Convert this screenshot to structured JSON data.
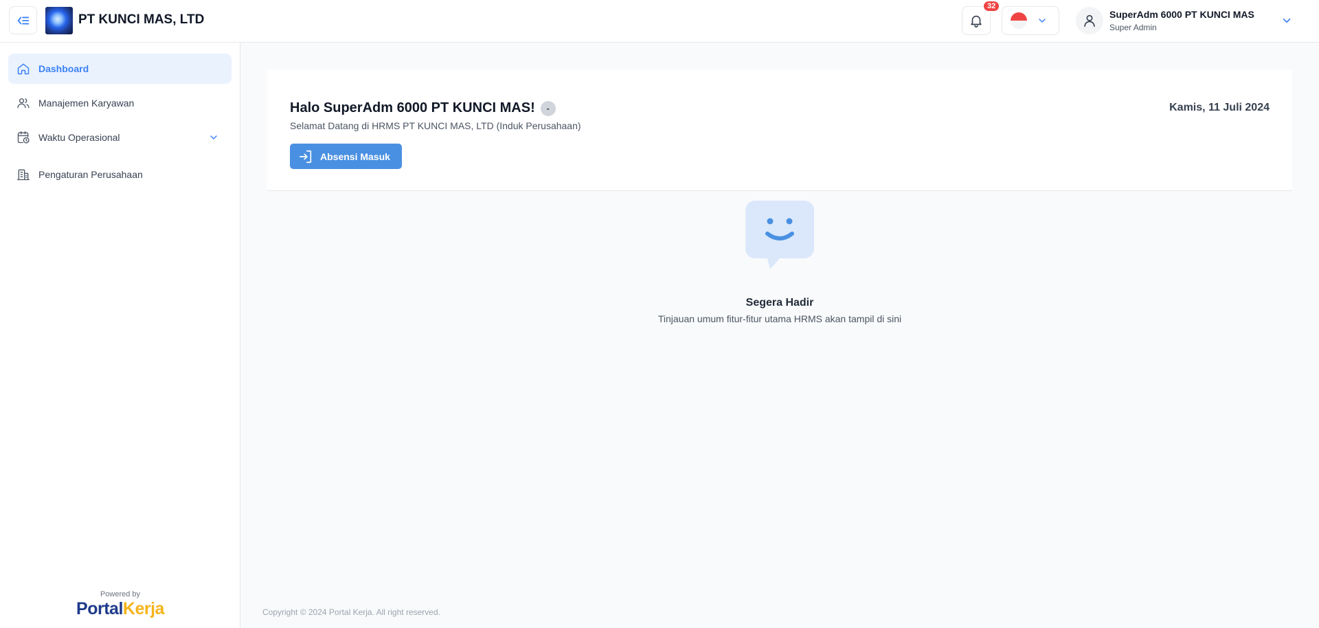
{
  "header": {
    "company_name": "PT KUNCI MAS, LTD",
    "notification_count": "32",
    "user_name": "SuperAdm 6000 PT KUNCI MAS",
    "user_role": "Super Admin"
  },
  "sidebar": {
    "items": [
      {
        "label": "Dashboard",
        "icon": "home-icon",
        "active": true
      },
      {
        "label": "Manajemen Karyawan",
        "icon": "users-icon"
      },
      {
        "label": "Waktu Operasional",
        "icon": "calendar-clock-icon",
        "expandable": true
      },
      {
        "label": "Pengaturan Perusahaan",
        "icon": "building-icon"
      }
    ],
    "powered_by": "Powered by",
    "brand_part1": "Portal",
    "brand_part2": "Kerja"
  },
  "welcome": {
    "greeting": "Halo SuperAdm 6000 PT KUNCI MAS!",
    "badge": "-",
    "subtitle": "Selamat Datang di HRMS PT KUNCI MAS, LTD (Induk Perusahaan)",
    "checkin_label": "Absensi Masuk",
    "date": "Kamis, 11 Juli 2024"
  },
  "empty_state": {
    "title": "Segera Hadir",
    "description": "Tinjauan umum fitur-fitur utama HRMS akan tampil di sini"
  },
  "footer": {
    "copyright": "Copyright © 2024 Portal Kerja. All right reserved."
  },
  "colors": {
    "accent": "#4a90e2",
    "active_bg": "#eaf2fe",
    "badge_red": "#ef4444",
    "brand_blue": "#1e3a8a",
    "brand_gold": "#f5b41a"
  }
}
